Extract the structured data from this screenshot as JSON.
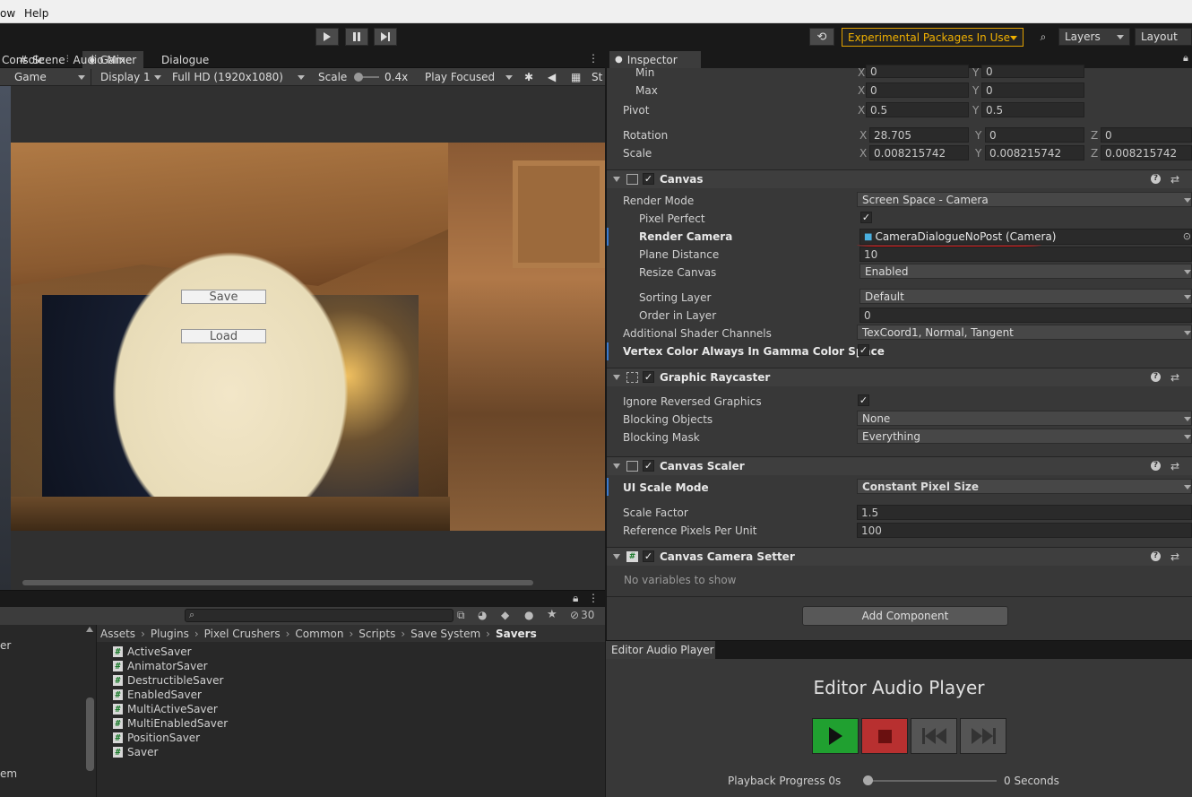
{
  "menu": {
    "item_partial": "ow",
    "help": "Help"
  },
  "toolbar": {
    "experimental_label": "Experimental Packages In Use",
    "layers_label": "Layers",
    "layout_label": "Layout"
  },
  "game_panel": {
    "tabs": [
      {
        "label": "Scene"
      },
      {
        "label": "Game"
      }
    ],
    "bar": {
      "mode": "Game",
      "display": "Display 1",
      "resolution": "Full HD (1920x1080)",
      "scale_label": "Scale",
      "scale_value": "0.4x",
      "play_mode": "Play Focused",
      "stats_partial": "St"
    },
    "ui_buttons": {
      "save": "Save",
      "load": "Load"
    }
  },
  "project_panel": {
    "tabs": [
      {
        "label": "Console"
      },
      {
        "label": "Audio Mixer"
      },
      {
        "label": "Dialogue"
      }
    ],
    "hidden_count": "30",
    "tree_partial": {
      "a": "er",
      "b": "em"
    },
    "breadcrumb": [
      "Assets",
      "Plugins",
      "Pixel Crushers",
      "Common",
      "Scripts",
      "Save System",
      "Savers"
    ],
    "files": [
      "ActiveSaver",
      "AnimatorSaver",
      "DestructibleSaver",
      "EnabledSaver",
      "MultiActiveSaver",
      "MultiEnabledSaver",
      "PositionSaver",
      "Saver"
    ]
  },
  "inspector": {
    "tab": "Inspector",
    "transform": {
      "min_label": "Min",
      "min_x": "0",
      "min_y": "0",
      "max_label": "Max",
      "max_x": "0",
      "max_y": "0",
      "pivot_label": "Pivot",
      "pivot_x": "0.5",
      "pivot_y": "0.5",
      "rotation_label": "Rotation",
      "rot_x": "28.705",
      "rot_y": "0",
      "rot_z": "0",
      "scale_label": "Scale",
      "scale_x": "0.008215742",
      "scale_y": "0.008215742",
      "scale_z": "0.008215742",
      "axis_x": "X",
      "axis_y": "Y",
      "axis_z": "Z"
    },
    "canvas": {
      "title": "Canvas",
      "render_mode_label": "Render Mode",
      "render_mode": "Screen Space - Camera",
      "pixel_perfect_label": "Pixel Perfect",
      "render_camera_label": "Render Camera",
      "render_camera": "CameraDialogueNoPost (Camera)",
      "plane_distance_label": "Plane Distance",
      "plane_distance": "10",
      "resize_canvas_label": "Resize Canvas",
      "resize_canvas": "Enabled",
      "sorting_layer_label": "Sorting Layer",
      "sorting_layer": "Default",
      "order_in_layer_label": "Order in Layer",
      "order_in_layer": "0",
      "shader_channels_label": "Additional Shader Channels",
      "shader_channels": "TexCoord1, Normal, Tangent",
      "vertex_color_label": "Vertex Color Always In Gamma Color Space"
    },
    "raycaster": {
      "title": "Graphic Raycaster",
      "ignore_reversed_label": "Ignore Reversed Graphics",
      "blocking_objects_label": "Blocking Objects",
      "blocking_objects": "None",
      "blocking_mask_label": "Blocking Mask",
      "blocking_mask": "Everything"
    },
    "scaler": {
      "title": "Canvas Scaler",
      "ui_scale_mode_label": "UI Scale Mode",
      "ui_scale_mode": "Constant Pixel Size",
      "scale_factor_label": "Scale Factor",
      "scale_factor": "1.5",
      "ref_ppu_label": "Reference Pixels Per Unit",
      "ref_ppu": "100"
    },
    "camera_setter": {
      "title": "Canvas Camera Setter",
      "no_vars": "No variables to show"
    },
    "add_component": "Add Component"
  },
  "audio_player": {
    "tab": "Editor Audio Player",
    "title": "Editor Audio Player",
    "progress_label": "Playback Progress 0s",
    "progress_value": 0,
    "seconds_label": "0 Seconds"
  },
  "colors": {
    "experimental_accent": "#f0b000",
    "play_green": "#20a030",
    "stop_red": "#b83030",
    "annotation_red": "#d01818"
  }
}
